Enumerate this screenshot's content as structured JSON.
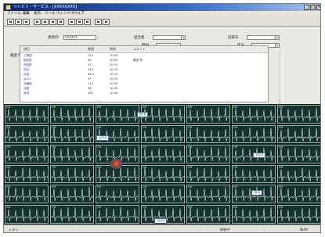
{
  "window": {
    "title": "リハビリ・サービス - [XXXXXXXX]",
    "controls": [
      "_",
      "□",
      "×"
    ]
  },
  "menu": [
    "ファイル",
    "編集",
    "表示",
    "ツール",
    "ウィンドウ",
    "ヘルプ"
  ],
  "toolbar": {
    "button_count": 12
  },
  "form": {
    "patient_id_label": "患者ID",
    "patient_id_value": "00XXXX",
    "field2_label": "担当者",
    "field3_label": "記録日",
    "field4_label": "開始",
    "field5_label": "区分",
    "section_label": "検査データ一覧",
    "list_headers": [
      "項目",
      "数値",
      "時刻",
      "コメント"
    ],
    "rows": [
      [
        "心電図",
        "120",
        "10:00",
        ""
      ],
      [
        "脈拍数",
        "98",
        "10:05",
        "異常 有"
      ],
      [
        "呼吸数",
        "22",
        "10:10",
        ""
      ],
      [
        "血圧",
        "130",
        "10:15",
        ""
      ],
      [
        "体温",
        "36.5",
        "10:20",
        ""
      ],
      [
        "SpO2",
        "97",
        "10:25",
        ""
      ],
      [
        "血糖値",
        "110",
        "10:30",
        ""
      ],
      [
        "体重",
        "58",
        "10:35",
        ""
      ],
      [
        "身長",
        "162",
        "10:40",
        ""
      ]
    ]
  },
  "wave": {
    "panel_label": "CH",
    "popups": [
      "123.0",
      "102.3",
      "88.6",
      "76.0",
      "110.4"
    ]
  },
  "statusbar": {
    "left": "レディ",
    "middle": "接続中",
    "right": "NUM"
  }
}
